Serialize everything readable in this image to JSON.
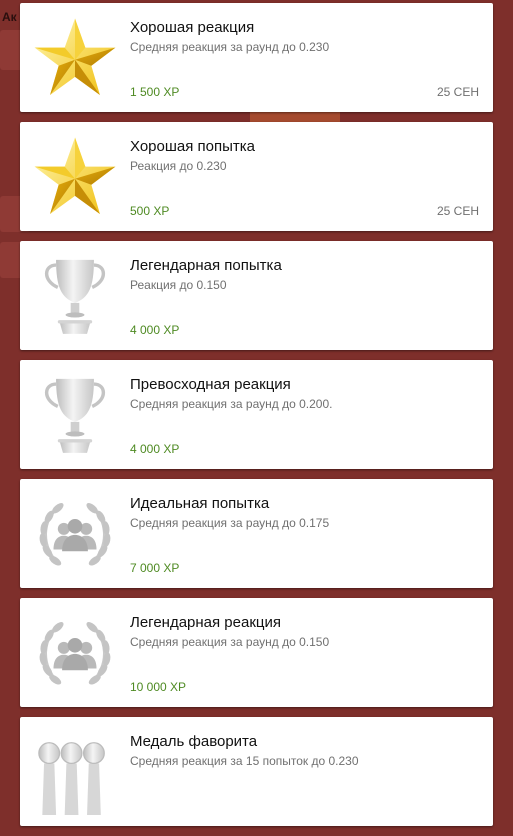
{
  "background": {
    "label": "Ак",
    "color": "#7e2f2b"
  },
  "achievements": [
    {
      "title": "Хорошая реакция",
      "description": "Средняя реакция за раунд до 0.230",
      "xp": "1 500 XP",
      "date": "25 СЕН",
      "icon": "gold-star-icon"
    },
    {
      "title": "Хорошая попытка",
      "description": "Реакция до 0.230",
      "xp": "500 XP",
      "date": "25 СЕН",
      "icon": "gold-star-icon"
    },
    {
      "title": "Легендарная попытка",
      "description": "Реакция до 0.150",
      "xp": "4 000 XP",
      "date": "",
      "icon": "silver-trophy-icon"
    },
    {
      "title": "Превосходная реакция",
      "description": "Средняя реакция за раунд до 0.200.",
      "xp": "4 000 XP",
      "date": "",
      "icon": "silver-trophy-icon"
    },
    {
      "title": "Идеальная попытка",
      "description": "Средняя реакция за раунд до 0.175",
      "xp": "7 000 XP",
      "date": "",
      "icon": "laurel-wreath-icon"
    },
    {
      "title": "Легендарная реакция",
      "description": "Средняя реакция за раунд до 0.150",
      "xp": "10 000 XP",
      "date": "",
      "icon": "laurel-wreath-icon"
    },
    {
      "title": "Медаль фаворита",
      "description": "Средняя реакция за 15 попыток до 0.230",
      "xp": "",
      "date": "",
      "icon": "ribbon-medals-icon"
    }
  ],
  "colors": {
    "xp": "#4e8a22",
    "gold": "#f2c315",
    "silver": "#c8c8c8"
  }
}
